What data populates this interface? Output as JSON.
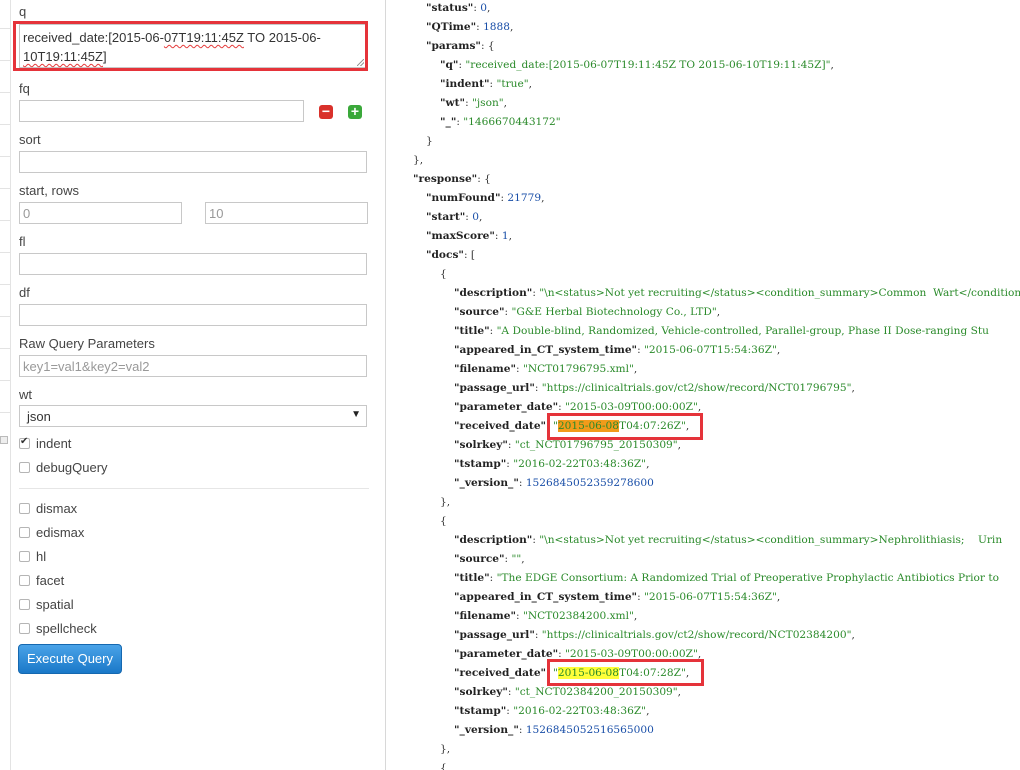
{
  "form": {
    "q_label": "q",
    "q_value_line1_a": "received_date:[2015-06-",
    "q_value_line1_b": "07T19:11:45Z",
    "q_value_line1_c": " TO 2015-06-",
    "q_value_line2": "10T19:11:45Z",
    "q_value_line2_end": "]",
    "fq_label": "fq",
    "fq_value": "",
    "sort_label": "sort",
    "sort_value": "",
    "start_rows_label": "start, rows",
    "start_placeholder": "0",
    "rows_placeholder": "10",
    "fl_label": "fl",
    "df_label": "df",
    "raw_label": "Raw Query Parameters",
    "raw_placeholder": "key1=val1&key2=val2",
    "wt_label": "wt",
    "wt_value": "json",
    "indent_label": "indent",
    "debug_label": "debugQuery",
    "dismax_label": "dismax",
    "edismax_label": "edismax",
    "hl_label": "hl",
    "facet_label": "facet",
    "spatial_label": "spatial",
    "spellcheck_label": "spellcheck",
    "execute_label": "Execute Query"
  },
  "json": {
    "status": "0",
    "qtime": "1888",
    "params_q": "\"received_date:[2015-06-07T19:11:45Z TO 2015-06-10T19:11:45Z]\"",
    "params_indent": "\"true\"",
    "params_wt": "\"json\"",
    "params_underscore": "\"1466670443172\"",
    "num_found": "21779",
    "start": "0",
    "max_score": "1",
    "doc1": {
      "description": "\"\\n<status>Not yet recruiting</status><condition_summary>Common  Wart</condition_summ",
      "source": "\"G&E Herbal Biotechnology Co., LTD\"",
      "title": "\"A Double-blind, Randomized, Vehicle-controlled, Parallel-group, Phase II Dose-ranging Stu",
      "appeared": "\"2015-06-07T15:54:36Z\"",
      "filename": "\"NCT01796795.xml\"",
      "passage_url": "\"https://clinicaltrials.gov/ct2/show/record/NCT01796795\"",
      "parameter_date": "\"2015-03-09T00:00:00Z\"",
      "received_hl": "2015-06-08",
      "received_rest": "T04:07:26Z\"",
      "solrkey": "\"ct_NCT01796795_20150309\"",
      "tstamp": "\"2016-02-22T03:48:36Z\"",
      "version": "1526845052359278600"
    },
    "doc2": {
      "description": "\"\\n<status>Not yet recruiting</status><condition_summary>Nephrolithiasis;    Urin",
      "source": "\"\"",
      "title": "\"The EDGE Consortium: A Randomized Trial of Preoperative Prophylactic Antibiotics Prior to",
      "appeared": "\"2015-06-07T15:54:36Z\"",
      "filename": "\"NCT02384200.xml\"",
      "passage_url": "\"https://clinicaltrials.gov/ct2/show/record/NCT02384200\"",
      "parameter_date": "\"2015-03-09T00:00:00Z\"",
      "received_hl": "2015-06-08",
      "received_rest": "T04:07:28Z\"",
      "solrkey": "\"ct_NCT02384200_20150309\"",
      "tstamp": "\"2016-02-22T03:48:36Z\"",
      "version": "1526845052516565000"
    }
  },
  "colors": {
    "highlight_box": "#e5333a",
    "primary_button": "#1a78c8",
    "json_string": "#2a8a2a",
    "json_number": "#1a4fa8"
  }
}
